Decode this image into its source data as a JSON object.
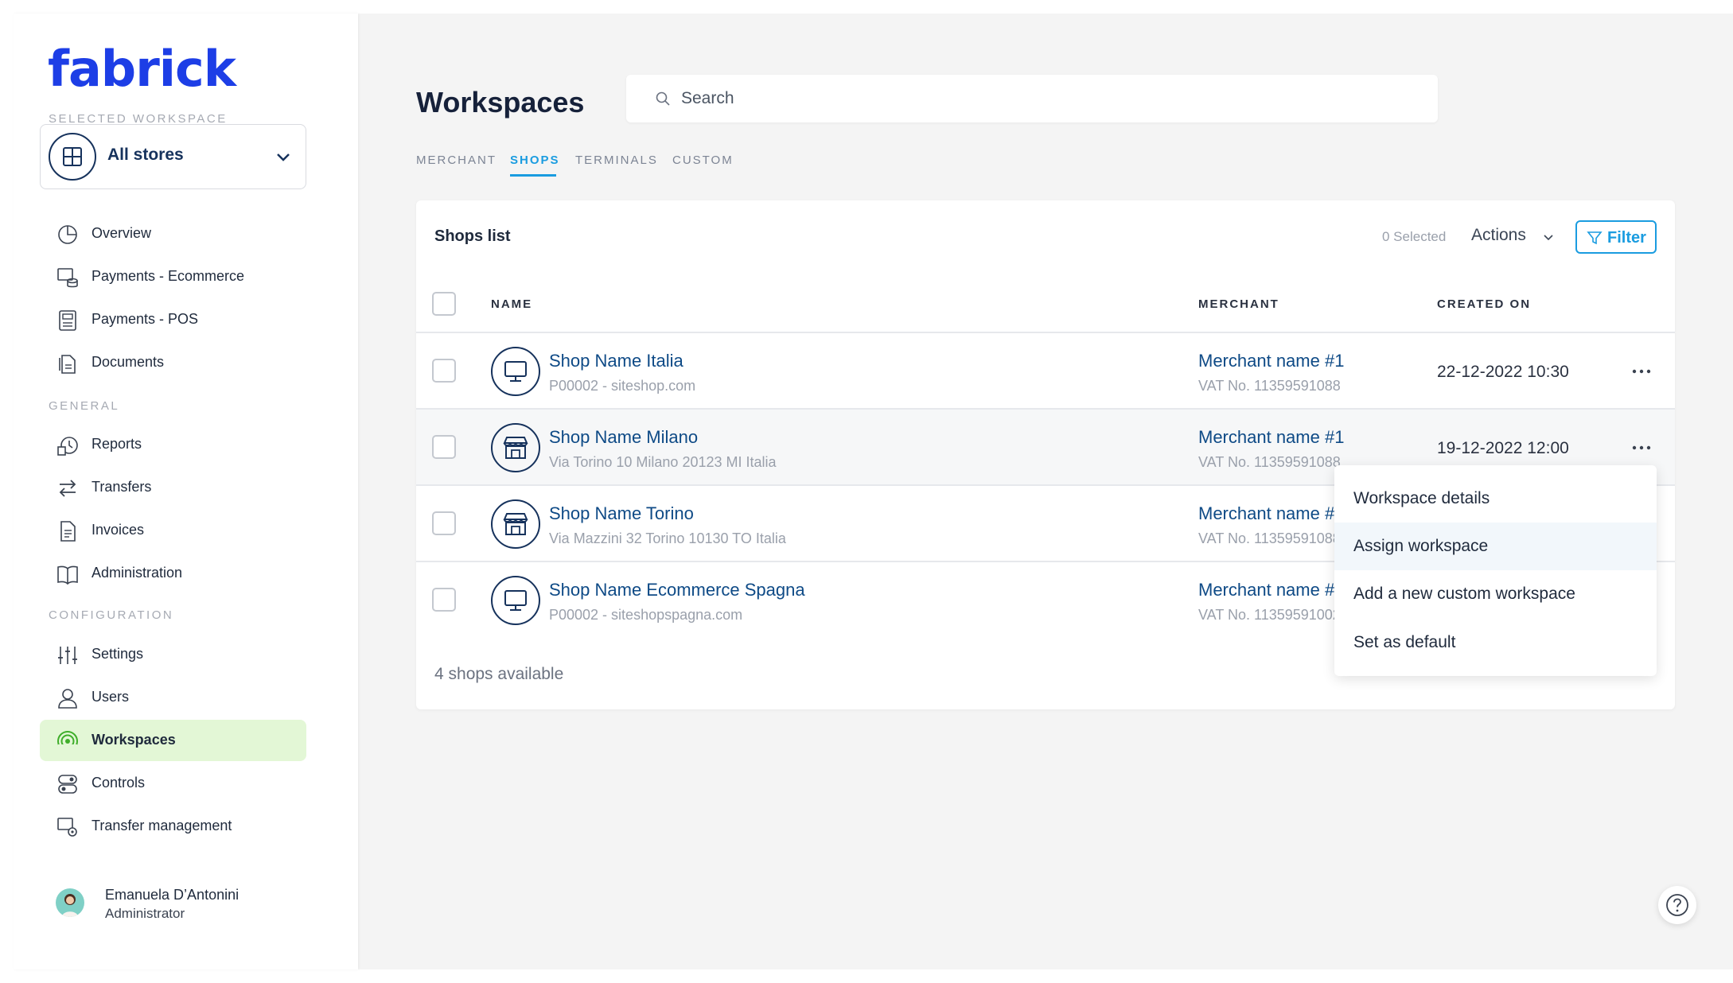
{
  "app": {
    "logo": "fabrick"
  },
  "sidebar": {
    "selected_workspace_label": "SELECTED WORKSPACE",
    "workspace": "All stores",
    "items": [
      {
        "label": "Overview",
        "icon": "pie-chart-icon"
      },
      {
        "label": "Payments - Ecommerce",
        "icon": "ecommerce-payments-icon"
      },
      {
        "label": "Payments - POS",
        "icon": "pos-terminal-icon"
      },
      {
        "label": "Documents",
        "icon": "documents-icon"
      }
    ],
    "general_label": "GENERAL",
    "general_items": [
      {
        "label": "Reports",
        "icon": "reports-icon"
      },
      {
        "label": "Transfers",
        "icon": "transfers-icon"
      },
      {
        "label": "Invoices",
        "icon": "invoices-icon"
      },
      {
        "label": "Administration",
        "icon": "book-icon"
      }
    ],
    "configuration_label": "CONFIGURATION",
    "configuration_items": [
      {
        "label": "Settings",
        "icon": "sliders-icon"
      },
      {
        "label": "Users",
        "icon": "user-icon"
      },
      {
        "label": "Workspaces",
        "icon": "workspaces-icon",
        "active": true
      },
      {
        "label": "Controls",
        "icon": "controls-icon"
      },
      {
        "label": "Transfer management",
        "icon": "transfer-management-icon"
      }
    ],
    "user": {
      "name": "Emanuela D’Antonini",
      "role": "Administrator"
    }
  },
  "main": {
    "title": "Workspaces",
    "search_placeholder": "Search",
    "tabs": [
      "MERCHANT",
      "SHOPS",
      "TERMINALS",
      "CUSTOM"
    ],
    "active_tab": "SHOPS",
    "card": {
      "title": "Shops list",
      "selected_count": "0 Selected",
      "actions_label": "Actions",
      "filter_label": "Filter",
      "columns": [
        "NAME",
        "MERCHANT",
        "CREATED ON"
      ],
      "rows": [
        {
          "name": "Shop Name Italia",
          "sub": "P00002 - siteshop.com",
          "icon": "monitor-icon",
          "merchant": "Merchant name #1",
          "vat": "VAT No. 11359591088",
          "created": "22-12-2022 10:30"
        },
        {
          "name": "Shop Name Milano",
          "sub": "Via Torino 10 Milano 20123 MI Italia",
          "icon": "store-icon",
          "merchant": "Merchant name #1",
          "vat": "VAT No. 11359591088",
          "created": "19-12-2022 12:00"
        },
        {
          "name": "Shop Name Torino",
          "sub": "Via Mazzini 32 Torino 10130 TO Italia",
          "icon": "store-icon",
          "merchant": "Merchant name #",
          "vat": "VAT No. 11359591088",
          "created": ""
        },
        {
          "name": "Shop Name Ecommerce Spagna",
          "sub": "P00002 - siteshopspagna.com",
          "icon": "monitor-icon",
          "merchant": "Merchant name #",
          "vat": "VAT No. 11359591002",
          "created": ""
        }
      ],
      "footer": "4 shops available"
    },
    "context_menu": {
      "items": [
        "Workspace details",
        "Assign workspace",
        "Add a new custom workspace",
        "Set as default"
      ],
      "highlighted": "Assign workspace"
    }
  },
  "colors": {
    "brand": "#1d3ee6",
    "accent": "#1a9ce0",
    "link": "#0e4a86",
    "active_nav_bg": "#e3f7d6"
  }
}
